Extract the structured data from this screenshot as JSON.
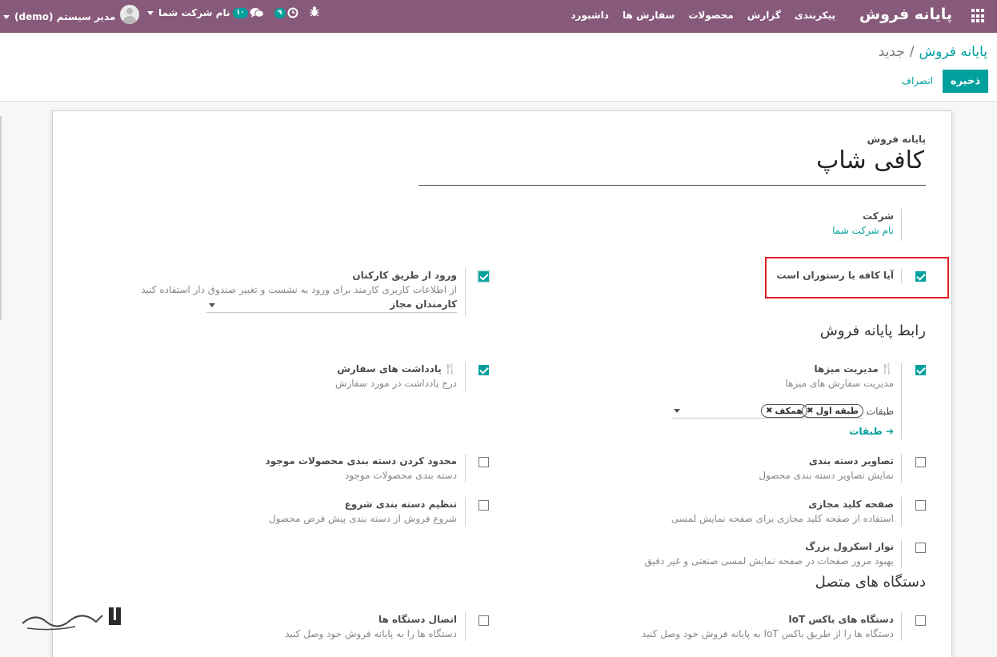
{
  "navbar": {
    "brand": "پایانه فروش",
    "menu": [
      "داشبورد",
      "سفارش ها",
      "محصولات",
      "گزارش",
      "پیکربندی"
    ],
    "user_label": "مدیر سیستم (demo)",
    "company_label": "نام شرکت شما",
    "chat_count": "۱۰",
    "activity_count": "۹",
    "icons": {
      "apps": "apps-grid-icon",
      "chat": "chat-icon",
      "activity": "clock-icon",
      "debug": "bug-icon"
    },
    "colors": {
      "bar": "#875a7b",
      "badge": "#00a09d"
    }
  },
  "control_panel": {
    "breadcrumb_parent": "پایانه فروش",
    "breadcrumb_separator": "/",
    "breadcrumb_current": "جدید",
    "save_label": "ذخیره",
    "discard_label": "انصراف"
  },
  "form": {
    "name_label": "پایانه فروش",
    "name_value": "کافی شاپ",
    "company": {
      "label": "شرکت",
      "value": "نام شرکت شما"
    },
    "is_restaurant": {
      "label": "آیا کافه یا رستوران است",
      "checked": true
    },
    "employee_login": {
      "title": "ورود از طریق کارکنان",
      "description": "از اطلاعات کاربری کارمند برای ورود به نشست و تغییر صندوق دار استفاده کنید",
      "select_value": "کارمندان مجاز",
      "checked": true
    },
    "section_interface": "رابط پایانه فروش",
    "table_management": {
      "title": "مدیریت میزها",
      "description": "مدیریت سفارش های میزها",
      "floors_label": "طبقات",
      "tags": [
        "طبقه اول",
        "همکف"
      ],
      "floors_link": "طبقات",
      "checked": true
    },
    "order_notes": {
      "title": "یادداشت های سفارش",
      "description": "درج یادداشت در مورد سفارش",
      "checked": true
    },
    "category_images": {
      "title": "تصاویر دسته بندی",
      "description": "نمایش تصاویر دسته بندی محصول",
      "checked": false
    },
    "restrict_categories": {
      "title": "محدود کردن دسته بندی محصولات موجود",
      "description": "دسته بندی محصولات موجود",
      "checked": false
    },
    "virtual_keyboard": {
      "title": "صفحه کلید مجازی",
      "description": "استفاده از صفحه کلید مجازی برای صفحه نمایش لمسی",
      "checked": false
    },
    "start_category": {
      "title": "تنظیم دسته بندی شروع",
      "description": "شروع فروش از دسته بندی پیش فرض محصول",
      "checked": false
    },
    "large_scrollbar": {
      "title": "نوار اسکرول بزرگ",
      "description": "بهبود مرور صفحات در صفحه نمایش لمسی صنعتی و غیر دقیق",
      "checked": false
    },
    "section_devices": "دستگاه های متصل",
    "iot_box": {
      "title": "دستگاه های باکس IoT",
      "description": "دستگاه ها را از طریق باکس IoT به پایانه فروش خود وصل کنید",
      "checked": false
    },
    "connect_devices": {
      "title": "اتصال دستگاه ها",
      "description": "دستگاه ها را به پایانه فروش خود وصل کنید",
      "checked": false
    }
  },
  "watermark": {
    "text": "تسهیل‌گستر"
  }
}
